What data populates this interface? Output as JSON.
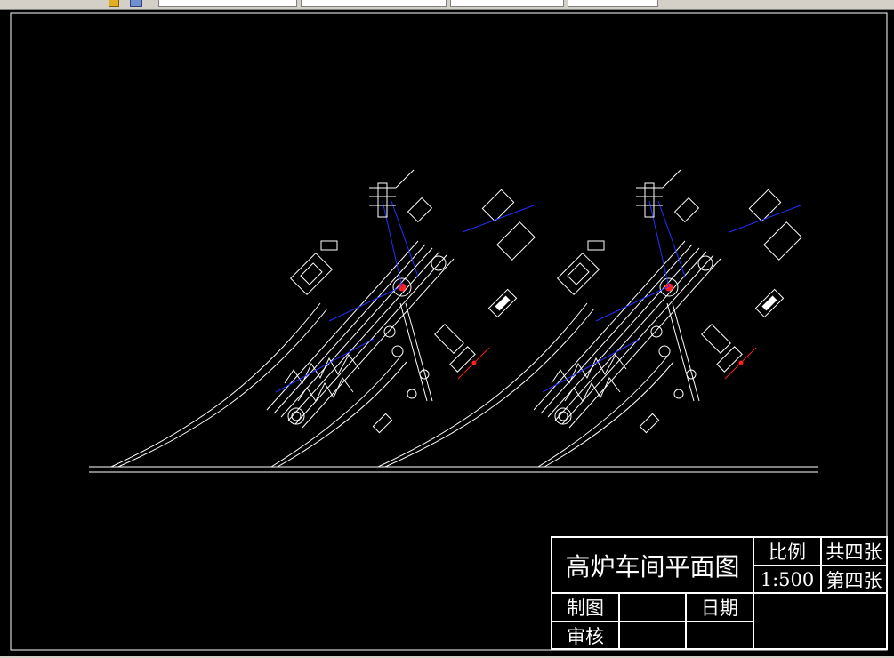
{
  "title_block": {
    "drawing_title": "高炉车间平面图",
    "scale_label": "比例",
    "scale_value": "1:500",
    "total_sheets": "共四张",
    "sheet_number": "第四张",
    "drawn_by_label": "制图",
    "date_label": "日期",
    "checked_by_label": "审核"
  },
  "colors": {
    "background": "#000000",
    "line": "#ffffff",
    "accent_blue": "#2030ff",
    "accent_red": "#ff2020",
    "toolbar": "#d4d0c8"
  }
}
